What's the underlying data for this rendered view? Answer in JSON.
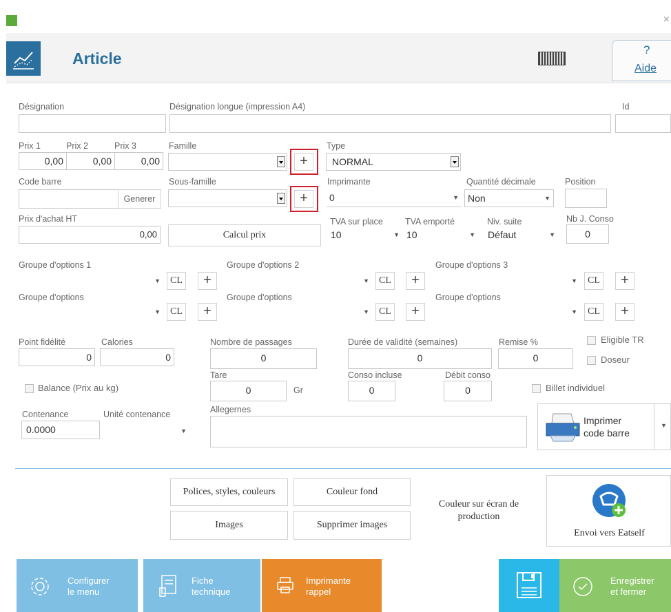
{
  "window": {
    "title": "Article",
    "help_label": "Aide",
    "help_mark": "?",
    "close": "×"
  },
  "fields": {
    "designation": {
      "label": "Désignation",
      "value": ""
    },
    "designation_longue": {
      "label": "Désignation longue (impression A4)",
      "value": ""
    },
    "id": {
      "label": "Id",
      "value": ""
    },
    "prix1": {
      "label": "Prix 1",
      "value": "0,00"
    },
    "prix2": {
      "label": "Prix 2",
      "value": "0,00"
    },
    "prix3": {
      "label": "Prix 3",
      "value": "0,00"
    },
    "famille": {
      "label": "Famille",
      "value": ""
    },
    "type": {
      "label": "Type",
      "value": "NORMAL"
    },
    "code_barre": {
      "label": "Code barre",
      "value": "",
      "button": "Generer"
    },
    "sous_famille": {
      "label": "Sous-famille",
      "value": ""
    },
    "imprimante": {
      "label": "Imprimante",
      "value": "0"
    },
    "quantite_decimale": {
      "label": "Quantité décimale",
      "value": "Non"
    },
    "position": {
      "label": "Position",
      "value": ""
    },
    "prix_achat": {
      "label": "Prix d'achat HT",
      "value": "0,00"
    },
    "calcul_prix": "Calcul prix",
    "tva_place": {
      "label": "TVA sur place",
      "value": "10"
    },
    "tva_emporte": {
      "label": "TVA emporté",
      "value": "10"
    },
    "niv_suite": {
      "label": "Niv. suite",
      "value": "Défaut"
    },
    "nb_conso": {
      "label": "Nb J. Conso",
      "value": "0"
    }
  },
  "options": {
    "row1": [
      "Groupe d'options 1",
      "Groupe d'options 2",
      "Groupe d'options 3"
    ],
    "row2": [
      "Groupe d'options",
      "Groupe d'options",
      "Groupe d'options"
    ],
    "cl": "CL",
    "plus": "+"
  },
  "misc": {
    "point_fidelite": {
      "label": "Point fidélité",
      "value": "0"
    },
    "calories": {
      "label": "Calories",
      "value": "0"
    },
    "nombre_passages": {
      "label": "Nombre de passages",
      "value": "0"
    },
    "duree_validite": {
      "label": "Durée de validité (semaines)",
      "value": "0"
    },
    "remise": {
      "label": "Remise %",
      "value": "0"
    },
    "eligible_tr": "Eligible TR",
    "doseur": "Doseur",
    "balance": "Balance (Prix au kg)",
    "tare": {
      "label": "Tare",
      "value": "0",
      "unit": "Gr"
    },
    "conso_incluse": {
      "label": "Conso incluse",
      "value": "0"
    },
    "debit_conso": {
      "label": "Débit conso",
      "value": "0"
    },
    "billet_individuel": "Billet individuel",
    "contenance": {
      "label": "Contenance",
      "value": "0.0000"
    },
    "unite_contenance": {
      "label": "Unité contenance",
      "value": ""
    },
    "allergenes": {
      "label": "Allegernes",
      "value": ""
    },
    "imprimer_code_barre_1": "Imprimer",
    "imprimer_code_barre_2": "code barre"
  },
  "style_buttons": {
    "polices": "Polices, styles, couleurs",
    "couleur_fond": "Couleur fond",
    "images": "Images",
    "supprimer_images": "Supprimer images",
    "couleur_ecran_1": "Couleur sur écran de",
    "couleur_ecran_2": "production",
    "eatself": "Envoi vers Eatself"
  },
  "footer": {
    "configurer_1": "Configurer",
    "configurer_2": "le menu",
    "fiche_1": "Fiche",
    "fiche_2": "technique",
    "imprimante_1": "Imprimante",
    "imprimante_2": "rappel",
    "enregistrer_1": "Enregistrer",
    "enregistrer_2": "et fermer"
  },
  "colors": {
    "header_bg": "#f3f3f3",
    "accent_blue": "#2a6f9e",
    "footer_blue": "#7fbfe4",
    "footer_orange": "#e8892c",
    "save_cyan": "#2ab8e8",
    "save_green": "#8cc86a",
    "red_highlight": "#d0202a"
  }
}
